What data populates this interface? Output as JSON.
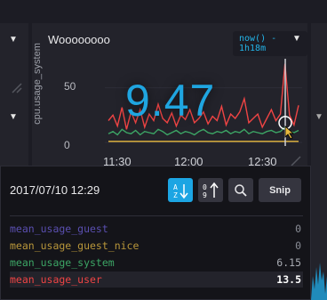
{
  "cell": {
    "title": "Woooooooo",
    "time_range": "now() - 1h18m",
    "big_value": "9.47",
    "y_axis_label": "cpu.usage_system"
  },
  "chart_data": {
    "type": "line",
    "y_ticks": [
      "50",
      "0"
    ],
    "x_ticks": [
      "11:30",
      "12:00",
      "12:30"
    ],
    "ylim": [
      0,
      75
    ],
    "hover_x": 0.93,
    "series": [
      {
        "name": "mean_usage_user",
        "color": "#ef4444",
        "values": [
          20,
          25,
          15,
          32,
          12,
          28,
          18,
          30,
          14,
          26,
          20,
          35,
          22,
          18,
          27,
          15,
          25,
          21,
          30,
          18,
          22,
          28,
          17,
          24,
          20,
          33,
          16,
          26,
          22,
          28,
          40,
          18,
          22,
          26,
          14,
          22,
          30,
          20,
          26,
          72,
          25,
          16,
          34
        ]
      },
      {
        "name": "mean_usage_system",
        "color": "#3ca565",
        "values": [
          8,
          10,
          7,
          12,
          9,
          8,
          11,
          7,
          10,
          9,
          8,
          12,
          10,
          7,
          9,
          11,
          8,
          10,
          9,
          7,
          10,
          12,
          9,
          8,
          10,
          9,
          11,
          8,
          10,
          9,
          12,
          8,
          10,
          9,
          8,
          10,
          11,
          9,
          10,
          14,
          10,
          9,
          11
        ]
      },
      {
        "name": "mean_usage_guest_nice",
        "color": "#e8b93e",
        "values": [
          1,
          1,
          1,
          1,
          1,
          1,
          1,
          1,
          1,
          1,
          1,
          1,
          1,
          1,
          1,
          1,
          1,
          1,
          1,
          1,
          1,
          1,
          1,
          1,
          1,
          1,
          1,
          1,
          1,
          1,
          1,
          1,
          1,
          1,
          1,
          1,
          1,
          1,
          1,
          1,
          1,
          1,
          1
        ]
      }
    ]
  },
  "tooltip": {
    "date": "2017/07/10 12:29",
    "snip_label": "Snip",
    "sort_alpha_label": "A Z",
    "sort_num_label": "0 9",
    "rows": [
      {
        "name": "mean_usage_guest",
        "value": "0",
        "color": "#5a4fb0",
        "value_color": "#8a8d96"
      },
      {
        "name": "mean_usage_guest_nice",
        "value": "0",
        "color": "#b8963a",
        "value_color": "#8a8d96"
      },
      {
        "name": "mean_usage_system",
        "value": "6.15",
        "color": "#3ca565",
        "value_color": "#a8abb2"
      },
      {
        "name": "mean_usage_user",
        "value": "13.5",
        "color": "#ef4444",
        "value_color": "#ffffff"
      }
    ]
  }
}
